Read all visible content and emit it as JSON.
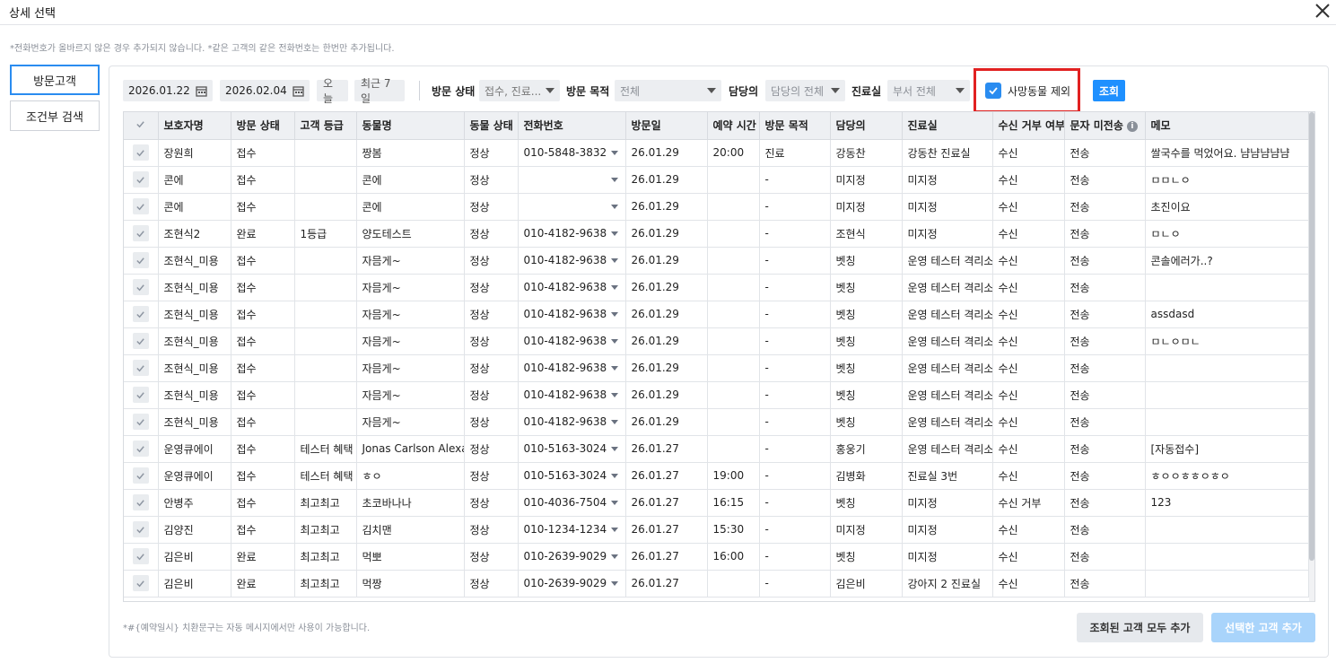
{
  "window": {
    "title": "상세 선택",
    "close_icon": "close-icon",
    "notice": "*전화번호가 올바르지 않은 경우 추가되지 않습니다. *같은 고객의 같은 전화번호는 한번만 추가됩니다."
  },
  "side_tabs": [
    {
      "label": "방문고객",
      "active": true
    },
    {
      "label": "조건부 검색",
      "active": false
    }
  ],
  "filters": {
    "date_from": "2026.01.22",
    "date_to": "2026.02.04",
    "calendar_icon": "calendar-icon",
    "today_label": "오늘",
    "last7_label": "최근 7일",
    "visit_status_label": "방문 상태",
    "visit_status_value": "접수, 진료...",
    "visit_purpose_label": "방문 목적",
    "visit_purpose_value": "전체",
    "manager_label": "담당의",
    "manager_value": "담당의 전체",
    "room_label": "진료실",
    "room_value": "부서 전체",
    "exclude_deceased_label": "사망동물 제외",
    "exclude_deceased_checked": true,
    "search_label": "조회"
  },
  "table": {
    "columns": [
      "보호자명",
      "방문 상태",
      "고객 등급",
      "동물명",
      "동물 상태",
      "전화번호",
      "방문일",
      "예약 시간",
      "방문 목적",
      "담당의",
      "진료실",
      "수신 거부 여부",
      "문자 미전송",
      "메모"
    ],
    "info_icon": "i",
    "rows": [
      [
        "장원희",
        "접수",
        "",
        "짱봄",
        "정상",
        "010-5848-3832",
        "26.01.29",
        "20:00",
        "진료",
        "강동찬",
        "강동찬 진료실",
        "수신",
        "전송",
        "쌀국수를 먹었어요. 냠냠냠냠냠"
      ],
      [
        "콘에",
        "접수",
        "",
        "콘에",
        "정상",
        "",
        "26.01.29",
        "",
        "-",
        "미지정",
        "미지정",
        "수신",
        "전송",
        "ㅁㅁㄴㅇ"
      ],
      [
        "콘에",
        "접수",
        "",
        "콘에",
        "정상",
        "",
        "26.01.29",
        "",
        "-",
        "미지정",
        "미지정",
        "수신",
        "전송",
        "초진이요"
      ],
      [
        "조현식2",
        "완료",
        "1등급",
        "양도테스트",
        "정상",
        "010-4182-9638",
        "26.01.29",
        "",
        "-",
        "조현식",
        "미지정",
        "수신",
        "전송",
        "ㅁㄴㅇ"
      ],
      [
        "조현식_미용",
        "접수",
        "",
        "자믐게~",
        "정상",
        "010-4182-9638",
        "26.01.29",
        "",
        "-",
        "벳칭",
        "운영 테스터 격리소",
        "수신",
        "전송",
        "콘솔에러가..?"
      ],
      [
        "조현식_미용",
        "접수",
        "",
        "자믐게~",
        "정상",
        "010-4182-9638",
        "26.01.29",
        "",
        "-",
        "벳칭",
        "운영 테스터 격리소",
        "수신",
        "전송",
        ""
      ],
      [
        "조현식_미용",
        "접수",
        "",
        "자믐게~",
        "정상",
        "010-4182-9638",
        "26.01.29",
        "",
        "-",
        "벳칭",
        "운영 테스터 격리소",
        "수신",
        "전송",
        "assdasd"
      ],
      [
        "조현식_미용",
        "접수",
        "",
        "자믐게~",
        "정상",
        "010-4182-9638",
        "26.01.29",
        "",
        "-",
        "벳칭",
        "운영 테스터 격리소",
        "수신",
        "전송",
        "ㅁㄴㅇㅁㄴ"
      ],
      [
        "조현식_미용",
        "접수",
        "",
        "자믐게~",
        "정상",
        "010-4182-9638",
        "26.01.29",
        "",
        "-",
        "벳칭",
        "운영 테스터 격리소",
        "수신",
        "전송",
        ""
      ],
      [
        "조현식_미용",
        "접수",
        "",
        "자믐게~",
        "정상",
        "010-4182-9638",
        "26.01.29",
        "",
        "-",
        "벳칭",
        "운영 테스터 격리소",
        "수신",
        "전송",
        ""
      ],
      [
        "조현식_미용",
        "접수",
        "",
        "자믐게~",
        "정상",
        "010-4182-9638",
        "26.01.29",
        "",
        "-",
        "벳칭",
        "운영 테스터 격리소",
        "수신",
        "전송",
        ""
      ],
      [
        "운영큐에이",
        "접수",
        "테스터 혜택",
        "Jonas Carlson Alexa",
        "정상",
        "010-5163-3024",
        "26.01.27",
        "",
        "-",
        "홍웅기",
        "운영 테스터 격리소",
        "수신",
        "전송",
        "[자동접수]"
      ],
      [
        "운영큐에이",
        "접수",
        "테스터 혜택",
        "ㅎㅇ",
        "정상",
        "010-5163-3024",
        "26.01.27",
        "19:00",
        "-",
        "김병화",
        "진료실 3번",
        "수신",
        "전송",
        "ㅎㅇㅇㅎㅎㅇㅎㅇ"
      ],
      [
        "안병주",
        "접수",
        "최고최고",
        "초코바나나",
        "정상",
        "010-4036-7504",
        "26.01.27",
        "16:15",
        "-",
        "벳칭",
        "미지정",
        "수신 거부",
        "전송",
        "123"
      ],
      [
        "김양진",
        "접수",
        "최고최고",
        "김치맨",
        "정상",
        "010-1234-1234",
        "26.01.27",
        "15:30",
        "-",
        "미지정",
        "미지정",
        "수신",
        "전송",
        ""
      ],
      [
        "김은비",
        "완료",
        "최고최고",
        "먹뽀",
        "정상",
        "010-2639-9029",
        "26.01.27",
        "16:00",
        "-",
        "벳칭",
        "미지정",
        "수신",
        "전송",
        ""
      ],
      [
        "김은비",
        "완료",
        "최고최고",
        "먹짱",
        "정상",
        "010-2639-9029",
        "26.01.27",
        "",
        "-",
        "김은비",
        "강아지 2 진료실",
        "수신",
        "전송",
        ""
      ]
    ]
  },
  "footer": {
    "note": "*#{예약일시} 치환문구는 자동 메시지에서만 사용이 가능합니다.",
    "add_all_label": "조회된 고객 모두 추가",
    "add_selected_label": "선택한 고객 추가"
  }
}
